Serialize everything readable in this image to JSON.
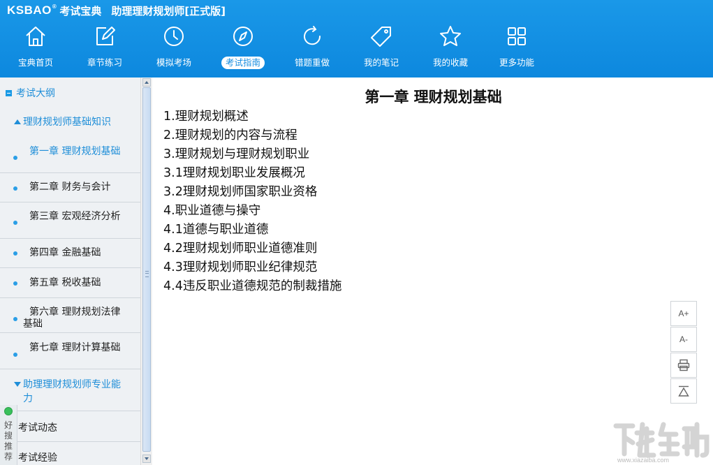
{
  "app": {
    "logo": "KSBAO",
    "name": "考试宝典",
    "title": "助理理财规划师[正式版]"
  },
  "nav": [
    {
      "label": "宝典首页",
      "icon": "home-icon"
    },
    {
      "label": "章节练习",
      "icon": "edit-icon"
    },
    {
      "label": "模拟考场",
      "icon": "clock-icon"
    },
    {
      "label": "考试指南",
      "icon": "compass-icon",
      "active": true
    },
    {
      "label": "错题重做",
      "icon": "refresh-icon"
    },
    {
      "label": "我的笔记",
      "icon": "tag-icon"
    },
    {
      "label": "我的收藏",
      "icon": "star-icon"
    },
    {
      "label": "更多功能",
      "icon": "grid-icon"
    }
  ],
  "sidebar": {
    "root": "考试大纲",
    "group1": "理财规划师基础知识",
    "chapters": [
      "第一章 理财规划基础",
      "第二章 财务与会计",
      "第三章 宏观经济分析",
      "第四章 金融基础",
      "第五章 税收基础",
      "第六章 理财规划法律基础",
      "第七章 理财计算基础"
    ],
    "group2": "助理理财规划师专业能力",
    "bottom": [
      "考试动态",
      "考试经验"
    ]
  },
  "recommend": "好搜推荐",
  "content": {
    "title": "第一章 理财规划基础",
    "items": [
      "1.理财规划概述",
      "2.理财规划的内容与流程",
      "3.理财规划与理财规划职业",
      "3.1理财规划职业发展概况",
      "3.2理财规划师国家职业资格",
      "4.职业道德与操守",
      "4.1道德与职业道德",
      "4.2理财规划师职业道德准则",
      "4.3理财规划师职业纪律规范",
      "4.4违反职业道德规范的制裁措施"
    ]
  },
  "tools": {
    "font_increase": "A+",
    "font_decrease": "A-"
  },
  "watermark": {
    "text": "www.xiazaiba.com"
  },
  "colors": {
    "header": "#1290e2",
    "accent": "#1f8ed8",
    "sidebar_bg": "#eef1f4"
  }
}
